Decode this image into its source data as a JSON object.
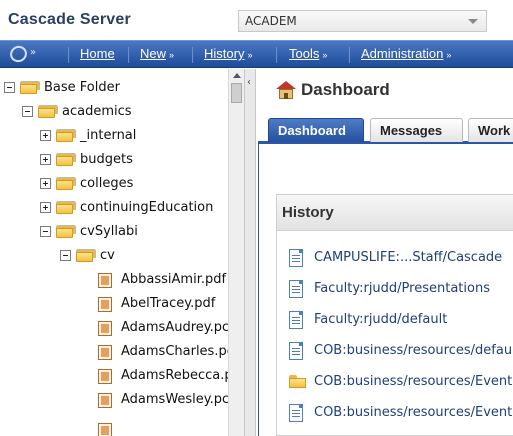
{
  "header": {
    "logo_text": "Cascade Server",
    "site_select": {
      "value": "ACADEM"
    }
  },
  "nav": {
    "items": [
      {
        "label": "Home"
      },
      {
        "label": "New"
      },
      {
        "label": "History"
      },
      {
        "label": "Tools"
      },
      {
        "label": "Administration"
      }
    ]
  },
  "tree": {
    "items": [
      {
        "label": "Base Folder",
        "type": "folder",
        "toggle": "minus"
      },
      {
        "label": "academics",
        "type": "folder",
        "toggle": "minus"
      },
      {
        "label": "_internal",
        "type": "folder",
        "toggle": "plus"
      },
      {
        "label": "budgets",
        "type": "folder",
        "toggle": "plus"
      },
      {
        "label": "colleges",
        "type": "folder",
        "toggle": "plus"
      },
      {
        "label": "continuingEducation",
        "type": "folder",
        "toggle": "plus"
      },
      {
        "label": "cvSyllabi",
        "type": "folder",
        "toggle": "minus"
      },
      {
        "label": "cv",
        "type": "folder",
        "toggle": "minus"
      },
      {
        "label": "AbbassiAmir.pdf",
        "type": "pdf"
      },
      {
        "label": "AbelTracey.pdf",
        "type": "pdf"
      },
      {
        "label": "AdamsAudrey.pc",
        "type": "pdf"
      },
      {
        "label": "AdamsCharles.pc",
        "type": "pdf"
      },
      {
        "label": "AdamsRebecca.p",
        "type": "pdf"
      },
      {
        "label": "AdamsWesley.pc",
        "type": "pdf"
      }
    ]
  },
  "content": {
    "title": "Dashboard",
    "tabs": [
      {
        "label": "Dashboard",
        "active": true
      },
      {
        "label": "Messages",
        "active": false
      },
      {
        "label": "Work",
        "active": false
      }
    ],
    "history": {
      "title": "History",
      "items": [
        {
          "label": "CAMPUSLIFE:...Staff/Cascade",
          "icon": "page-icon"
        },
        {
          "label": "Faculty:rjudd/Presentations",
          "icon": "page-icon"
        },
        {
          "label": "Faculty:rjudd/default",
          "icon": "page-icon"
        },
        {
          "label": "COB:business/resources/defau",
          "icon": "page-icon"
        },
        {
          "label": "COB:business/resources/Event",
          "icon": "folder-icon"
        },
        {
          "label": "COB:business/resources/Event",
          "icon": "page-icon"
        }
      ]
    }
  }
}
